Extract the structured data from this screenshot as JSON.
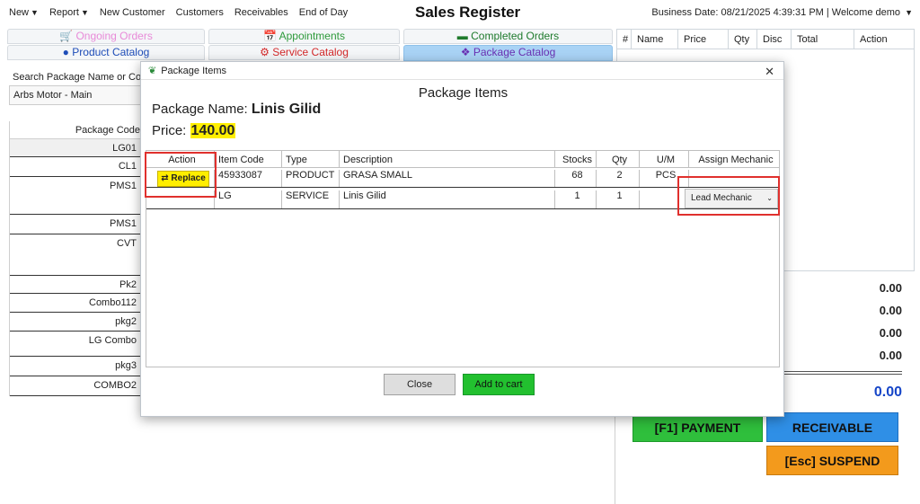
{
  "menu": {
    "new": "New",
    "report": "Report",
    "new_customer": "New Customer",
    "customers": "Customers",
    "receivables": "Receivables",
    "end_of_day": "End of Day"
  },
  "app_title": "Sales Register",
  "business_info": "Business Date: 08/21/2025 4:39:31 PM   |   Welcome demo",
  "tabs": {
    "ongoing": "Ongoing Orders",
    "appointments": "Appointments",
    "completed": "Completed Orders",
    "product_catalog": "Product Catalog",
    "service_catalog": "Service Catalog",
    "package_catalog": "Package Catalog"
  },
  "colors": {
    "ongoing": "#e88ad8",
    "appointments": "#2e9a3b",
    "completed": "#1e7a2c",
    "product": "#1e4db8",
    "service": "#d4292a",
    "package": "#6a2fb3"
  },
  "left": {
    "search_label": "Search Package Name or Code",
    "branch": "Arbs Motor - Main",
    "column": "Package Code",
    "codes": [
      "LG01",
      "CL1",
      "PMS1",
      "PMS1",
      "CVT",
      "Pk2",
      "Combo112",
      "pkg2",
      "LG Combo",
      "pkg3",
      "COMBO2"
    ]
  },
  "cart": {
    "columns": [
      "#",
      "Name",
      "Price",
      "Qty",
      "Disc",
      "Total",
      "Action"
    ],
    "totals": [
      "0.00",
      "0.00",
      "0.00",
      "0.00"
    ],
    "grand_total": "0.00",
    "payment": "[F1] PAYMENT",
    "receivable": "RECEIVABLE",
    "suspend": "[Esc] SUSPEND"
  },
  "modal": {
    "title": "Package Items",
    "heading": "Package Items",
    "name_label": "Package Name:",
    "name_value": "Linis Gilid",
    "price_label": "Price:",
    "price_value": "140.00",
    "columns": [
      "Action",
      "Item Code",
      "Type",
      "Description",
      "Stocks",
      "Qty",
      "U/M",
      "Assign Mechanic"
    ],
    "rows": [
      {
        "action": "Replace",
        "code": "45933087",
        "type": "PRODUCT",
        "description": "GRASA SMALL",
        "stocks": "68",
        "qty": "2",
        "um": "PCS",
        "mechanic": ""
      },
      {
        "action": "",
        "code": "LG",
        "type": "SERVICE",
        "description": "Linis Gilid",
        "stocks": "1",
        "qty": "1",
        "um": "",
        "mechanic": "Lead Mechanic"
      }
    ],
    "close": "Close",
    "add_to_cart": "Add to cart"
  }
}
